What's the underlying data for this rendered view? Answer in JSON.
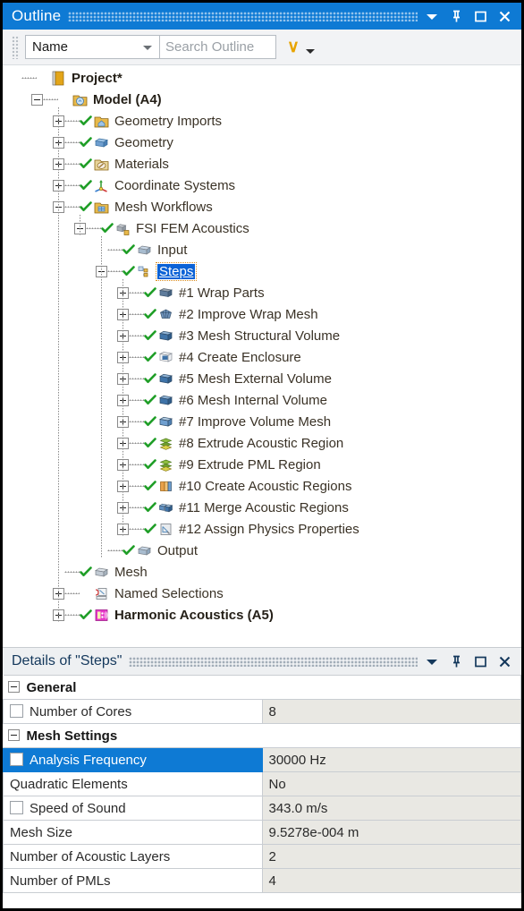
{
  "outline_panel": {
    "title": "Outline",
    "window_buttons": [
      "caret-down",
      "pin",
      "maximize",
      "close"
    ],
    "toolbar": {
      "filter_value": "Name",
      "search_placeholder": "Search Outline",
      "expand_chevron": "∨"
    },
    "accent_blue": "#0e7ad4",
    "selection_blue": "#0b62d6",
    "tree": [
      {
        "label": "Project*",
        "indent": 0,
        "expander": "none",
        "check": false,
        "icon": "project-icon",
        "bold": true,
        "selected": false
      },
      {
        "label": "Model (A4)",
        "indent": 1,
        "expander": "minus",
        "check": false,
        "icon": "model-icon",
        "bold": true,
        "selected": false
      },
      {
        "label": "Geometry Imports",
        "indent": 2,
        "expander": "plus",
        "check": true,
        "icon": "geometry-imports-icon",
        "bold": false,
        "selected": false
      },
      {
        "label": "Geometry",
        "indent": 2,
        "expander": "plus",
        "check": true,
        "icon": "geometry-icon",
        "bold": false,
        "selected": false
      },
      {
        "label": "Materials",
        "indent": 2,
        "expander": "plus",
        "check": true,
        "icon": "materials-icon",
        "bold": false,
        "selected": false
      },
      {
        "label": "Coordinate Systems",
        "indent": 2,
        "expander": "plus",
        "check": true,
        "icon": "coordinate-systems-icon",
        "bold": false,
        "selected": false
      },
      {
        "label": "Mesh Workflows",
        "indent": 2,
        "expander": "minus",
        "check": true,
        "icon": "mesh-workflows-icon",
        "bold": false,
        "selected": false
      },
      {
        "label": "FSI FEM Acoustics",
        "indent": 3,
        "expander": "minus",
        "check": true,
        "icon": "workflow-icon",
        "bold": false,
        "selected": false
      },
      {
        "label": "Input",
        "indent": 4,
        "expander": "none",
        "check": true,
        "icon": "input-icon",
        "bold": false,
        "selected": false
      },
      {
        "label": "Steps",
        "indent": 4,
        "expander": "minus",
        "check": true,
        "icon": "steps-icon",
        "bold": false,
        "selected": true
      },
      {
        "label": "#1 Wrap Parts",
        "indent": 5,
        "expander": "plus",
        "check": true,
        "icon": "wrap-parts-icon",
        "bold": false,
        "selected": false
      },
      {
        "label": "#2 Improve Wrap Mesh",
        "indent": 5,
        "expander": "plus",
        "check": true,
        "icon": "improve-wrap-mesh-icon",
        "bold": false,
        "selected": false
      },
      {
        "label": "#3 Mesh Structural Volume",
        "indent": 5,
        "expander": "plus",
        "check": true,
        "icon": "mesh-volume-icon",
        "bold": false,
        "selected": false
      },
      {
        "label": "#4 Create Enclosure",
        "indent": 5,
        "expander": "plus",
        "check": true,
        "icon": "create-enclosure-icon",
        "bold": false,
        "selected": false
      },
      {
        "label": "#5 Mesh External Volume",
        "indent": 5,
        "expander": "plus",
        "check": true,
        "icon": "mesh-volume-icon",
        "bold": false,
        "selected": false
      },
      {
        "label": "#6 Mesh Internal Volume",
        "indent": 5,
        "expander": "plus",
        "check": true,
        "icon": "mesh-volume-icon",
        "bold": false,
        "selected": false
      },
      {
        "label": "#7 Improve Volume Mesh",
        "indent": 5,
        "expander": "plus",
        "check": true,
        "icon": "improve-volume-mesh-icon",
        "bold": false,
        "selected": false
      },
      {
        "label": "#8 Extrude Acoustic Region",
        "indent": 5,
        "expander": "plus",
        "check": true,
        "icon": "extrude-icon",
        "bold": false,
        "selected": false
      },
      {
        "label": "#9 Extrude PML Region",
        "indent": 5,
        "expander": "plus",
        "check": true,
        "icon": "extrude-icon",
        "bold": false,
        "selected": false
      },
      {
        "label": "#10 Create Acoustic Regions",
        "indent": 5,
        "expander": "plus",
        "check": true,
        "icon": "create-regions-icon",
        "bold": false,
        "selected": false
      },
      {
        "label": "#11 Merge Acoustic Regions",
        "indent": 5,
        "expander": "plus",
        "check": true,
        "icon": "merge-regions-icon",
        "bold": false,
        "selected": false
      },
      {
        "label": "#12 Assign Physics Properties",
        "indent": 5,
        "expander": "plus",
        "check": true,
        "icon": "assign-physics-icon",
        "bold": false,
        "selected": false
      },
      {
        "label": "Output",
        "indent": 4,
        "expander": "none",
        "check": true,
        "icon": "output-icon",
        "bold": false,
        "selected": false
      },
      {
        "label": "Mesh",
        "indent": 2,
        "expander": "none",
        "check": true,
        "icon": "mesh-icon",
        "bold": false,
        "selected": false
      },
      {
        "label": "Named Selections",
        "indent": 2,
        "expander": "plus",
        "check": false,
        "icon": "named-selections-icon",
        "bold": false,
        "selected": false
      },
      {
        "label": "Harmonic Acoustics (A5)",
        "indent": 2,
        "expander": "plus",
        "check": true,
        "icon": "harmonic-acoustics-icon",
        "bold": true,
        "selected": false
      }
    ]
  },
  "details_panel": {
    "title": "Details of \"Steps\"",
    "window_buttons": [
      "caret-down",
      "pin",
      "maximize",
      "close"
    ],
    "sections": [
      {
        "name": "General",
        "rows": [
          {
            "label": "Number of Cores",
            "value": "8",
            "checkbox": true,
            "highlighted": false
          }
        ]
      },
      {
        "name": "Mesh Settings",
        "rows": [
          {
            "label": "Analysis Frequency",
            "value": "30000 Hz",
            "checkbox": true,
            "highlighted": true
          },
          {
            "label": "Quadratic Elements",
            "value": "No",
            "checkbox": false,
            "highlighted": false
          },
          {
            "label": "Speed of Sound",
            "value": "343.0 m/s",
            "checkbox": true,
            "highlighted": false
          },
          {
            "label": "Mesh Size",
            "value": "9.5278e-004 m",
            "checkbox": false,
            "highlighted": false
          },
          {
            "label": "Number of Acoustic Layers",
            "value": "2",
            "checkbox": false,
            "highlighted": false
          },
          {
            "label": "Number of PMLs",
            "value": "4",
            "checkbox": false,
            "highlighted": false
          }
        ]
      }
    ]
  }
}
